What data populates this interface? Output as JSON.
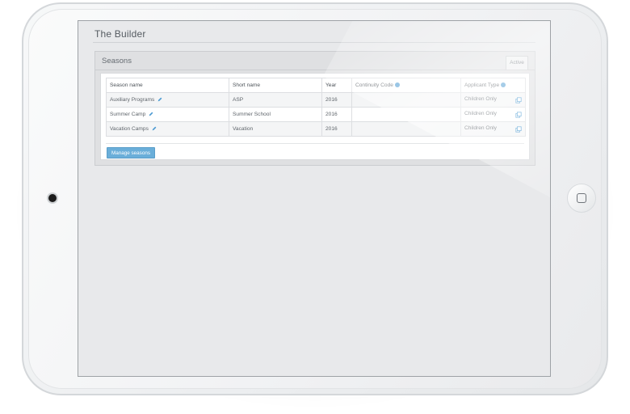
{
  "page": {
    "title": "The Builder"
  },
  "panel": {
    "title": "Seasons",
    "active_tab": "Active",
    "manage_button": "Manage seasons"
  },
  "table": {
    "headers": [
      "Season name",
      "Short name",
      "Year",
      "Continuity Code",
      "Applicant Type"
    ],
    "rows": [
      {
        "season_name": "Auxiliary Programs",
        "short_name": "ASP",
        "year": "2016",
        "continuity_code": "",
        "applicant_type": "Children Only"
      },
      {
        "season_name": "Summer Camp",
        "short_name": "Summer School",
        "year": "2016",
        "continuity_code": "",
        "applicant_type": "Children Only"
      },
      {
        "season_name": "Vacation Camps",
        "short_name": "Vacation",
        "year": "2016",
        "continuity_code": "",
        "applicant_type": "Children Only"
      }
    ]
  },
  "icons": {
    "help": "question-circle-icon",
    "edit": "pencil-icon",
    "copy": "copy-icon"
  },
  "colors": {
    "accent": "#4d9bd2",
    "button": "#6aaed9",
    "screen_bg": "#e8e9eb"
  }
}
